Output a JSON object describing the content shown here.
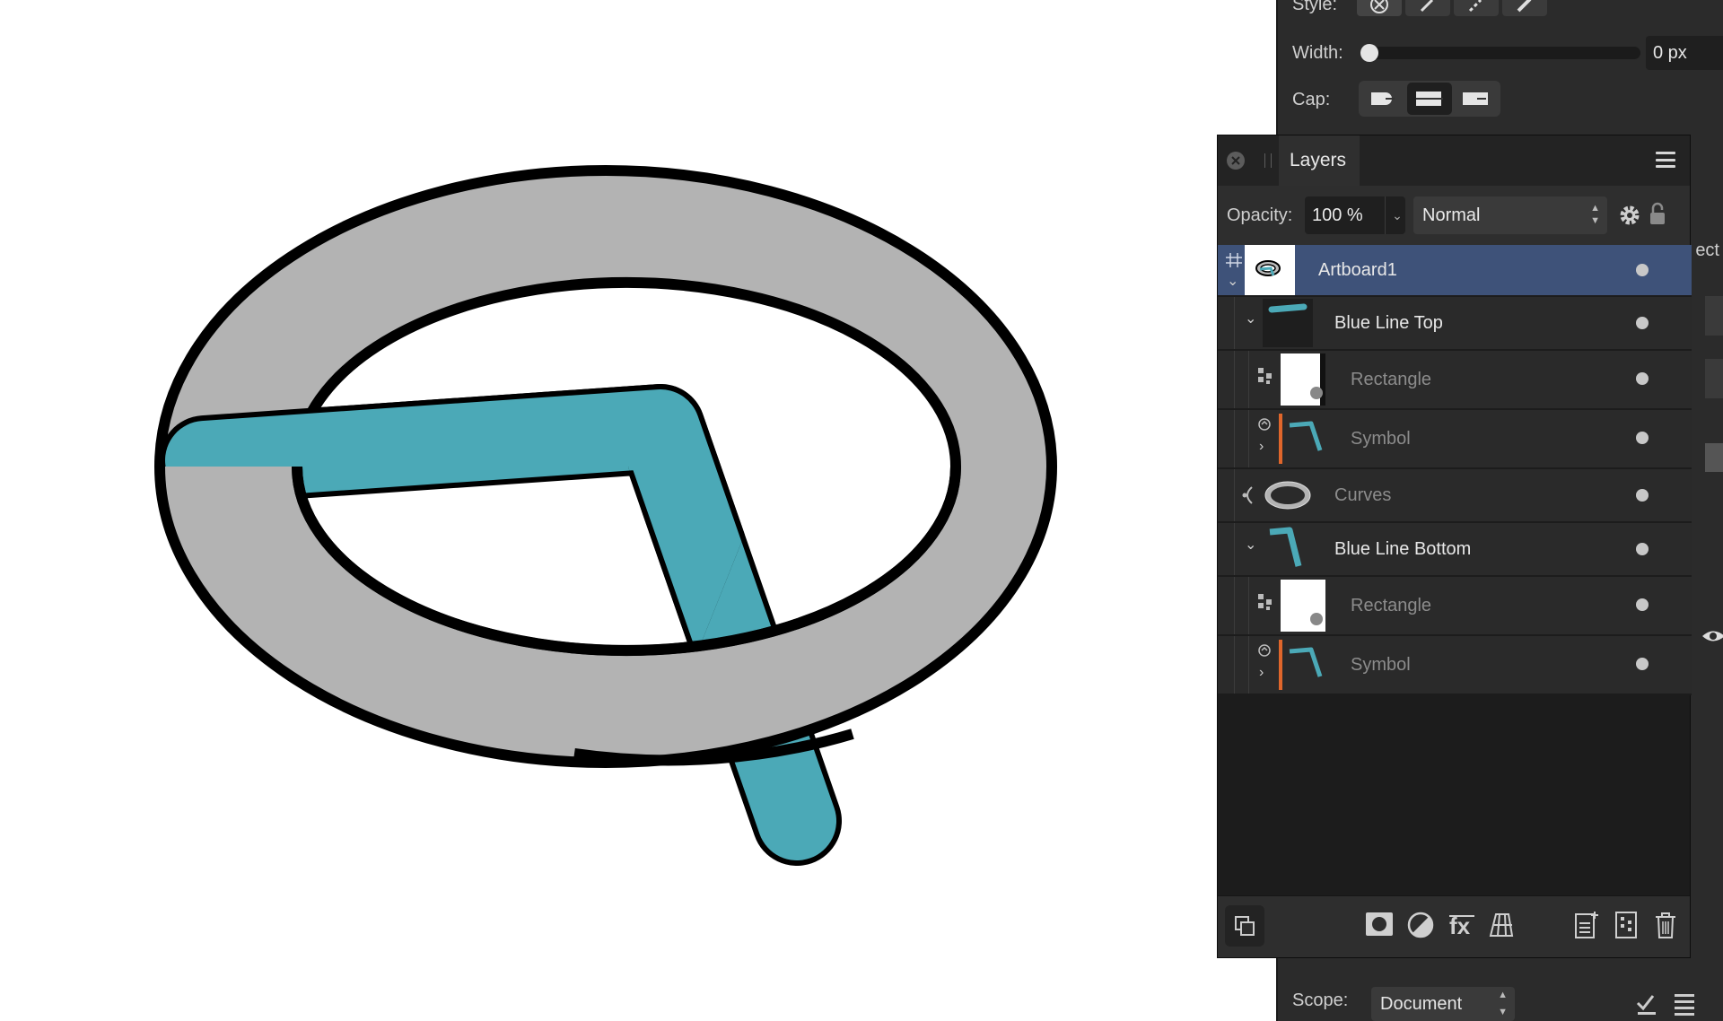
{
  "canvas": {
    "colors": {
      "ring_fill": "#b3b3b3",
      "outline": "#000000",
      "blue_line": "#4ba9b7",
      "background": "#ffffff"
    }
  },
  "stroke_panel": {
    "style_label": "Style:",
    "width_label": "Width:",
    "width_value": "0 px",
    "cap_label": "Cap:",
    "right_partial_label": "ect",
    "scope_label": "Scope:",
    "scope_value": "Document"
  },
  "layers_panel": {
    "title": "Layers",
    "opacity_label": "Opacity:",
    "opacity_value": "100 %",
    "blend_mode": "Normal",
    "selection_color": "#3e5279",
    "rows": [
      {
        "name": "Artboard1",
        "dim": false,
        "selected": true
      },
      {
        "name": "Blue Line Top",
        "dim": false,
        "selected": false
      },
      {
        "name": "Rectangle",
        "dim": true,
        "selected": false
      },
      {
        "name": "Symbol",
        "dim": true,
        "selected": false
      },
      {
        "name": "Curves",
        "dim": true,
        "selected": false
      },
      {
        "name": "Blue Line Bottom",
        "dim": false,
        "selected": false
      },
      {
        "name": "Rectangle",
        "dim": true,
        "selected": false
      },
      {
        "name": "Symbol",
        "dim": true,
        "selected": false
      }
    ],
    "footer_icons": [
      "arrange-layers-icon",
      "mask-icon",
      "adjustment-icon",
      "fx-icon",
      "live-filter-icon",
      "add-layer-icon",
      "add-pixel-layer-icon",
      "trash-icon"
    ]
  }
}
